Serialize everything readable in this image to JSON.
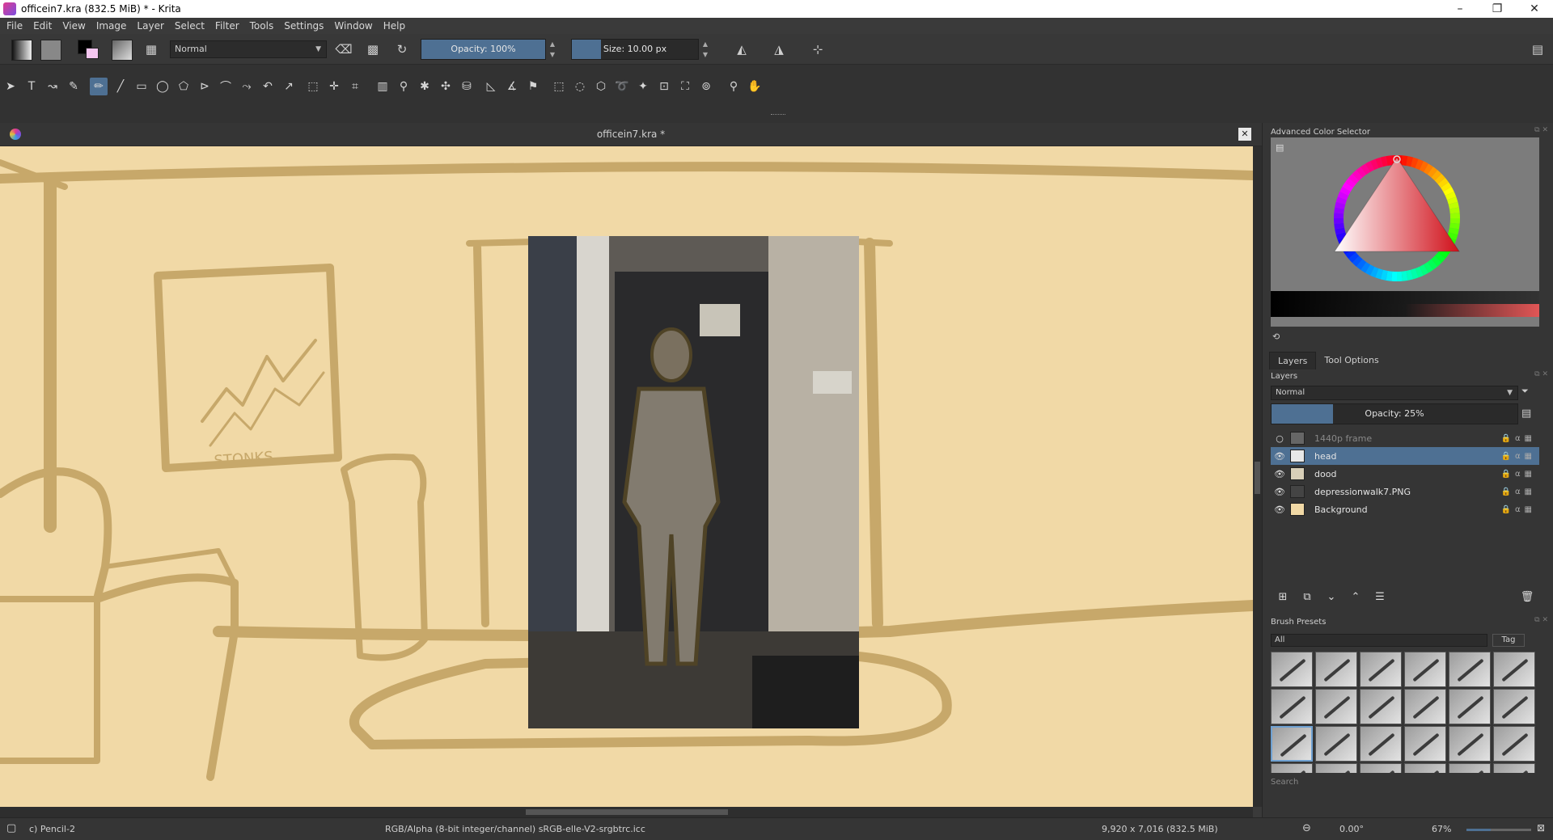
{
  "window": {
    "title": "officein7.kra (832.5 MiB)  * - Krita",
    "minimize": "–",
    "restore": "❐",
    "close": "✕"
  },
  "menu": [
    "File",
    "Edit",
    "View",
    "Image",
    "Layer",
    "Select",
    "Filter",
    "Tools",
    "Settings",
    "Window",
    "Help"
  ],
  "options_bar": {
    "blend_mode": "Normal",
    "opacity_label": "Opacity: 100%",
    "opacity_value": 100,
    "size_label": "Size: 10.00 px",
    "foreground_color": "#000000",
    "background_color": "#f5c6f0"
  },
  "document": {
    "tab_title": "officein7.kra *",
    "canvas_bg": "#f1d9a6",
    "sketch_color": "#c7a86a",
    "sketch_text": "STONKS"
  },
  "docker": {
    "color_selector_title": "Advanced Color Selector",
    "tabs": [
      "Layers",
      "Tool Options"
    ],
    "layers_title": "Layers",
    "layer_blend": "Normal",
    "layer_opacity_label": "Opacity:  25%",
    "layer_opacity_value": 25,
    "layers": [
      {
        "name": "1440p frame",
        "visible": false,
        "active": false
      },
      {
        "name": "head",
        "visible": true,
        "active": true
      },
      {
        "name": "dood",
        "visible": true,
        "active": false
      },
      {
        "name": "depressionwalk7.PNG",
        "visible": true,
        "active": false
      },
      {
        "name": "Background",
        "visible": true,
        "active": false
      }
    ],
    "brush_presets_title": "Brush Presets",
    "preset_filter": "All",
    "tag_label": "Tag",
    "search_placeholder": "Search"
  },
  "status": {
    "brush": "c) Pencil-2",
    "color_space": "RGB/Alpha (8-bit integer/channel)  sRGB-elle-V2-srgbtrc.icc",
    "dimensions": "9,920 x 7,016 (832.5 MiB)",
    "rotation": "0.00°",
    "zoom": "67%"
  }
}
